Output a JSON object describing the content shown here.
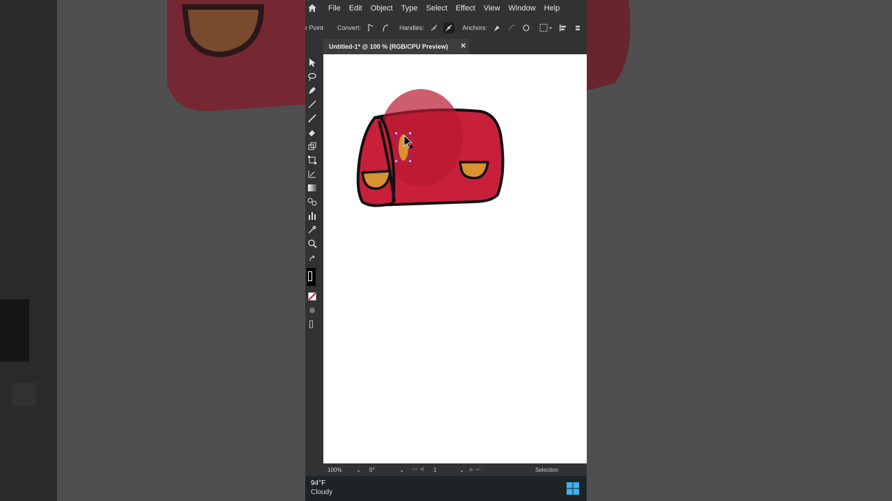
{
  "menubar": {
    "items": [
      "File",
      "Edit",
      "Object",
      "Type",
      "Select",
      "Effect",
      "View",
      "Window",
      "Help"
    ]
  },
  "control_bar": {
    "tool_label": "r Point",
    "convert_label": "Convert:",
    "handles_label": "Handles:",
    "anchors_label": "Anchors:"
  },
  "document": {
    "tab_title": "Untitled-1* @ 100 % (RGB/CPU Preview)",
    "close_glyph": "✕"
  },
  "status_bar": {
    "zoom": "100%",
    "rotation": "0°",
    "artboard": "1",
    "tool": "Selection"
  },
  "taskbar": {
    "temperature": "94°F",
    "condition": "Cloudy"
  },
  "colors": {
    "bag_red": "#c8203a",
    "bag_shadow": "#b81a32",
    "pocket_orange": "#d99131",
    "selection_accent": "#7a3ad1",
    "ui_dark": "#323232"
  },
  "icons": {
    "home": "home-icon",
    "selection": "selection-arrow-icon",
    "pen": "pen-icon",
    "brush": "brush-icon",
    "eraser": "eraser-icon",
    "zoom": "zoom-icon",
    "windows": "windows-start-icon"
  }
}
